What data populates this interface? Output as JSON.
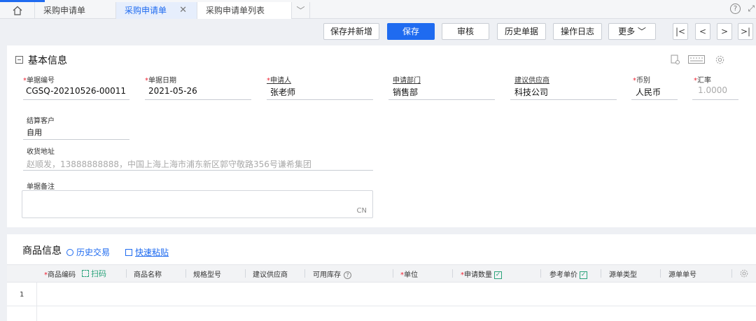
{
  "tabs": {
    "home_icon": "home-icon",
    "items": [
      {
        "label": "采购申请单",
        "active": false
      },
      {
        "label": "采购申请单",
        "active": true
      },
      {
        "label": "采购申请单列表",
        "active": false
      }
    ],
    "close_glyph": "✕",
    "more_glyph": "﹀",
    "help_glyph": "?",
    "expand_glyph": "⤢"
  },
  "toolbar": {
    "save_new": "保存并新增",
    "save": "保存",
    "audit": "审核",
    "history": "历史单据",
    "log": "操作日志",
    "more": "更多 ﹀",
    "first": "|<",
    "prev": "<",
    "next": ">",
    "last": ">|"
  },
  "basic": {
    "title": "基本信息",
    "fields": {
      "doc_no": {
        "label": "单据编号",
        "value": "CGSQ-20210526-00011"
      },
      "doc_date": {
        "label": "单据日期",
        "value": "2021-05-26"
      },
      "applicant": {
        "label": "申请人",
        "value": "张老师"
      },
      "department": {
        "label": "申请部门",
        "value": "销售部"
      },
      "supplier": {
        "label": "建议供应商",
        "value": "科技公司"
      },
      "currency": {
        "label": "币别",
        "value": "人民币"
      },
      "rate": {
        "label": "汇率",
        "value": "1.0000"
      },
      "customer": {
        "label": "结算客户",
        "value": "自用"
      },
      "address": {
        "label": "收货地址",
        "value": "赵顺发，13888888888，中国上海上海市浦东新区郭守敬路356号谦希集团"
      },
      "remark": {
        "label": "单据备注",
        "value": "",
        "counter": "CN"
      }
    }
  },
  "goods": {
    "title": "商品信息",
    "history_link": "历史交易",
    "paste_link": "快速粘贴",
    "columns": {
      "code": "商品编码",
      "scan": "扫码",
      "name": "商品名称",
      "spec": "规格型号",
      "supplier": "建议供应商",
      "stock": "可用库存",
      "unit": "单位",
      "qty": "申请数量",
      "price": "参考单价",
      "src_type": "源单类型",
      "src_no": "源单单号"
    },
    "rows": [
      {
        "no": "1"
      }
    ]
  }
}
